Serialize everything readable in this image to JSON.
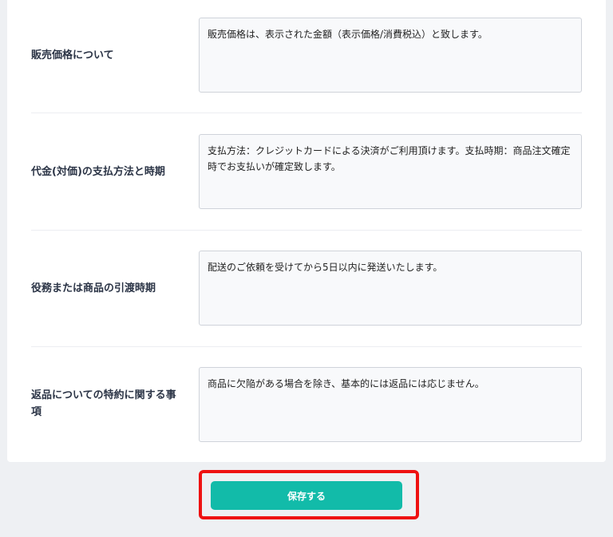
{
  "form": {
    "fields": [
      {
        "label": "販売価格について",
        "value": "販売価格は、表示された金額（表示価格/消費税込）と致します。"
      },
      {
        "label": "代金(対価)の支払方法と時期",
        "value": "支払方法：クレジットカードによる決済がご利用頂けます。支払時期：商品注文確定時でお支払いが確定致します。"
      },
      {
        "label": "役務または商品の引渡時期",
        "value": "配送のご依頼を受けてから5日以内に発送いたします。"
      },
      {
        "label": "返品についての特約に関する事項",
        "value": "商品に欠陥がある場合を除き、基本的には返品には応じません。"
      }
    ]
  },
  "actions": {
    "save_label": "保存する"
  },
  "colors": {
    "accent": "#12bba9",
    "highlight": "#ee1111",
    "background": "#eef0f3"
  }
}
